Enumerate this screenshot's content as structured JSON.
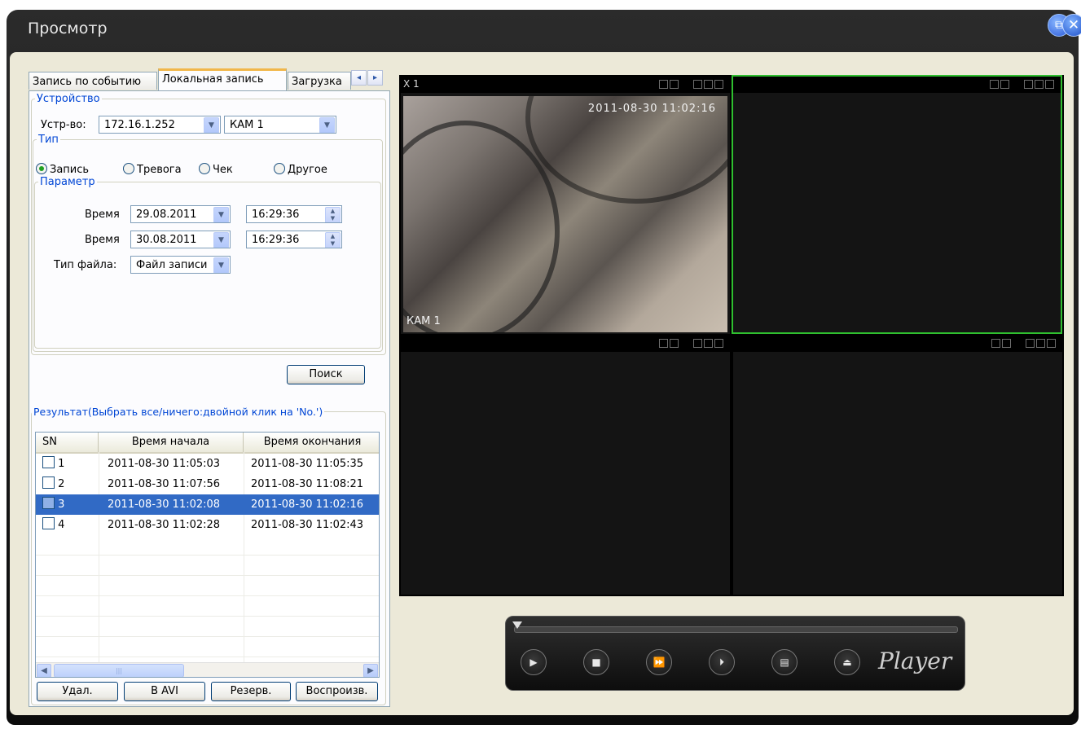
{
  "window": {
    "title": "Просмотр",
    "restore_icon": "restore-icon",
    "close_icon": "close-icon"
  },
  "tabs": [
    {
      "label": "Запись по событию"
    },
    {
      "label": "Локальная запись"
    },
    {
      "label": "Загрузка"
    }
  ],
  "tab_arrows": {
    "left": "◂",
    "right": "▸"
  },
  "device": {
    "legend": "Устройство",
    "label": "Устр-во:",
    "ip": "172.16.1.252",
    "camera": "КАМ 1"
  },
  "type": {
    "legend": "Тип",
    "options": [
      {
        "label": "Запись",
        "checked": true
      },
      {
        "label": "Тревога",
        "checked": false
      },
      {
        "label": "Чек",
        "checked": false
      },
      {
        "label": "Другое",
        "checked": false
      }
    ]
  },
  "params": {
    "legend": "Параметр",
    "time_label": "Время",
    "start_date": "29.08.2011",
    "start_time": "16:29:36",
    "end_date": "30.08.2011",
    "end_time": "16:29:36",
    "file_type_label": "Тип файла:",
    "file_type": "Файл записи"
  },
  "search_label": "Поиск",
  "results": {
    "legend": "Результат(Выбрать все/ничего:двойной клик на 'No.')",
    "columns": [
      "SN",
      "Время начала",
      "Время окончания"
    ],
    "rows": [
      {
        "sn": "1",
        "start": "2011-08-30 11:05:03",
        "end": "2011-08-30 11:05:35",
        "selected": false
      },
      {
        "sn": "2",
        "start": "2011-08-30 11:07:56",
        "end": "2011-08-30 11:08:21",
        "selected": false
      },
      {
        "sn": "3",
        "start": "2011-08-30 11:02:08",
        "end": "2011-08-30 11:02:16",
        "selected": true
      },
      {
        "sn": "4",
        "start": "2011-08-30 11:02:28",
        "end": "2011-08-30 11:02:43",
        "selected": false
      }
    ],
    "scroll_left": "◀",
    "scroll_right": "▶",
    "scroll_thumb": "|||"
  },
  "actions": {
    "delete": "Удал.",
    "to_avi": "В AVI",
    "backup": "Резерв.",
    "play": "Воспроизв."
  },
  "video": {
    "pane1_label": "X 1",
    "timestamp": "2011-08-30 11:02:16",
    "camera_overlay": "КАМ 1",
    "active_border": "#2fbf2f"
  },
  "player": {
    "brand": "Player",
    "buttons": [
      "play-icon",
      "stop-icon",
      "fast-forward-icon",
      "step-icon",
      "playlist-icon",
      "eject-icon"
    ],
    "glyphs": [
      "▶",
      "■",
      "⏩",
      "⏵",
      "▤",
      "⏏"
    ],
    "progress": 0
  }
}
